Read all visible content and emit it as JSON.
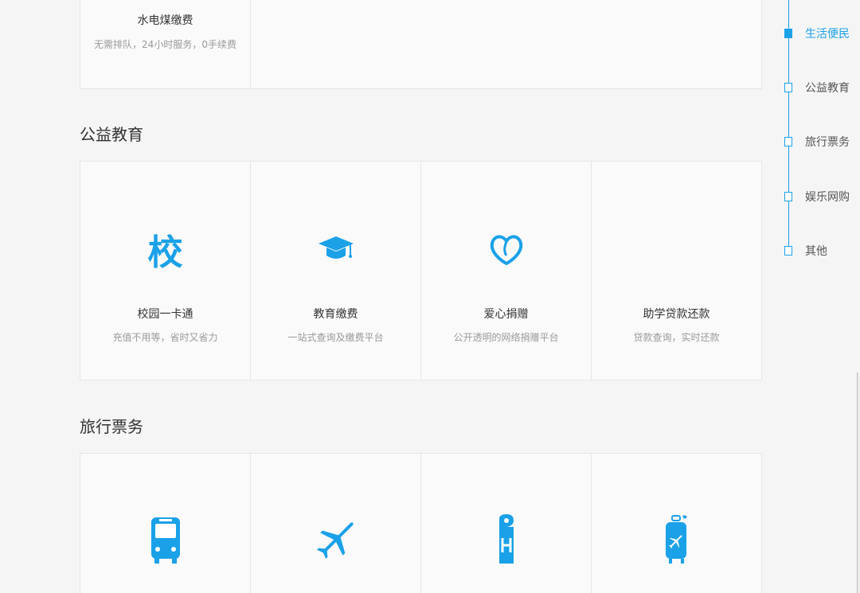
{
  "sections": {
    "life": {
      "cards": [
        {
          "title": "水电煤缴费",
          "desc": "无需排队，24小时服务，0手续费"
        },
        {
          "title": "",
          "desc": ""
        }
      ]
    },
    "edu": {
      "title": "公益教育",
      "cards": [
        {
          "title": "校园一卡通",
          "desc": "充值不用等，省时又省力",
          "icon_glyph": "校",
          "icon": "school-char-icon"
        },
        {
          "title": "教育缴费",
          "desc": "一站式查询及缴费平台",
          "icon": "graduation-cap-icon"
        },
        {
          "title": "爱心捐赠",
          "desc": "公开透明的网络捐赠平台",
          "icon": "heart-icon"
        },
        {
          "title": "助学贷款还款",
          "desc": "贷款查询，实时还款",
          "icon": "loan-icon"
        }
      ]
    },
    "travel": {
      "title": "旅行票务",
      "cards": [
        {
          "icon": "bus-icon"
        },
        {
          "icon": "airplane-icon"
        },
        {
          "icon": "hotel-tag-icon"
        },
        {
          "icon": "luggage-icon"
        }
      ]
    }
  },
  "side_nav": {
    "items": [
      {
        "label": "生活便民",
        "active": true
      },
      {
        "label": "公益教育",
        "active": false
      },
      {
        "label": "旅行票务",
        "active": false
      },
      {
        "label": "娱乐网购",
        "active": false
      },
      {
        "label": "其他",
        "active": false
      }
    ]
  },
  "colors": {
    "accent": "#1aa1e8",
    "border": "#e6e6e6",
    "card_bg": "#fafafa",
    "page_bg": "#f5f5f5"
  }
}
